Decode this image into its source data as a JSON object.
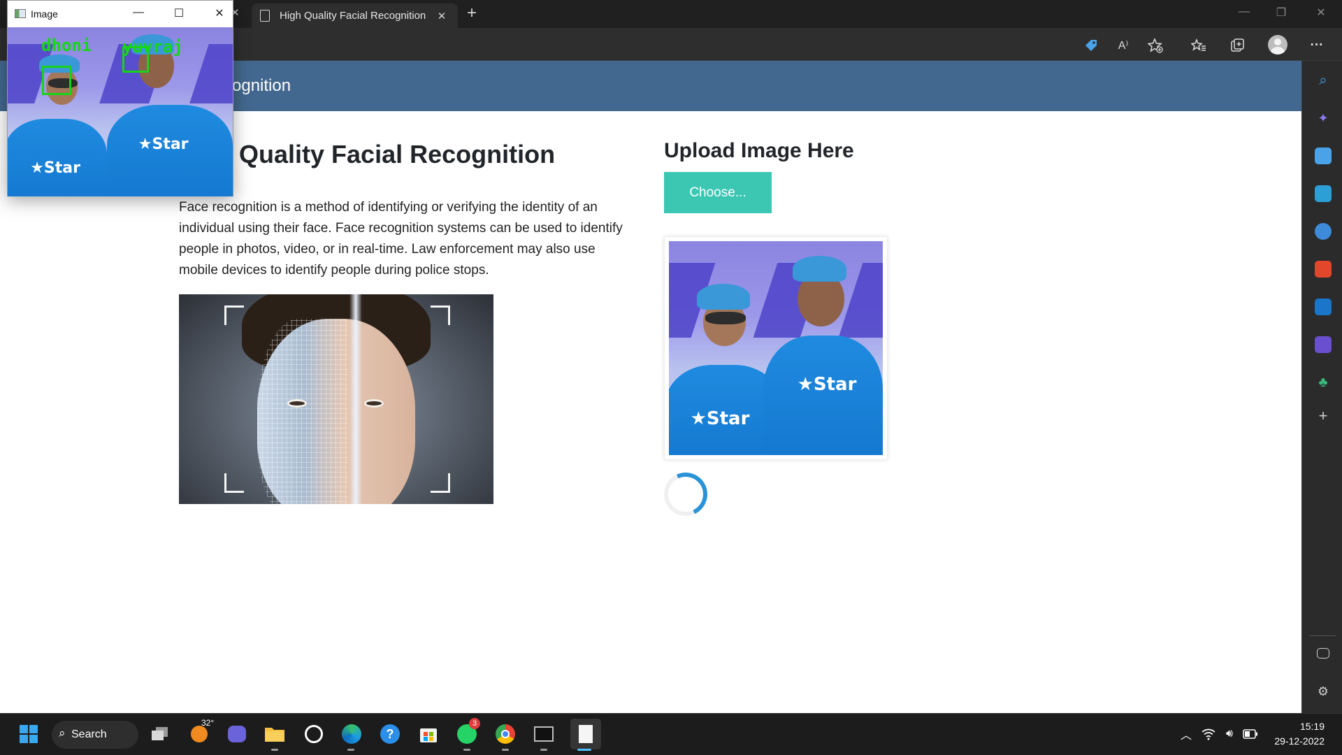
{
  "browser": {
    "active_tab_title": "High Quality Facial Recognition",
    "tab_close_glyph": "✕",
    "new_tab_glyph": "+",
    "toolbar_icons": [
      "tag-icon",
      "read-aloud-icon",
      "add-favorite-icon",
      "favorites-icon",
      "collections-icon",
      "profile-icon",
      "more-icon"
    ],
    "read_aloud_text": "A⁾",
    "more_glyph": "···"
  },
  "image_window": {
    "title": "Image",
    "detections": [
      "dhoni",
      "yuvraj"
    ],
    "detection_color": "#18d418"
  },
  "page": {
    "header_brand": "cognition",
    "heading": "Quality Facial Recognition",
    "intro": "Face recognition is a method of identifying or verifying the identity of an individual using their face. Face recognition systems can be used to identify people in photos, video, or in real-time. Law enforcement may also use mobile devices to identify people during police stops.",
    "upload_heading": "Upload Image Here",
    "choose_label": "Choose...",
    "header_color": "#43688f",
    "button_color": "#3cc7b3"
  },
  "taskbar": {
    "search_label": "Search",
    "weather_temp": "32°",
    "whatsapp_badge": "3",
    "time": "15:19",
    "date": "29-12-2022"
  }
}
